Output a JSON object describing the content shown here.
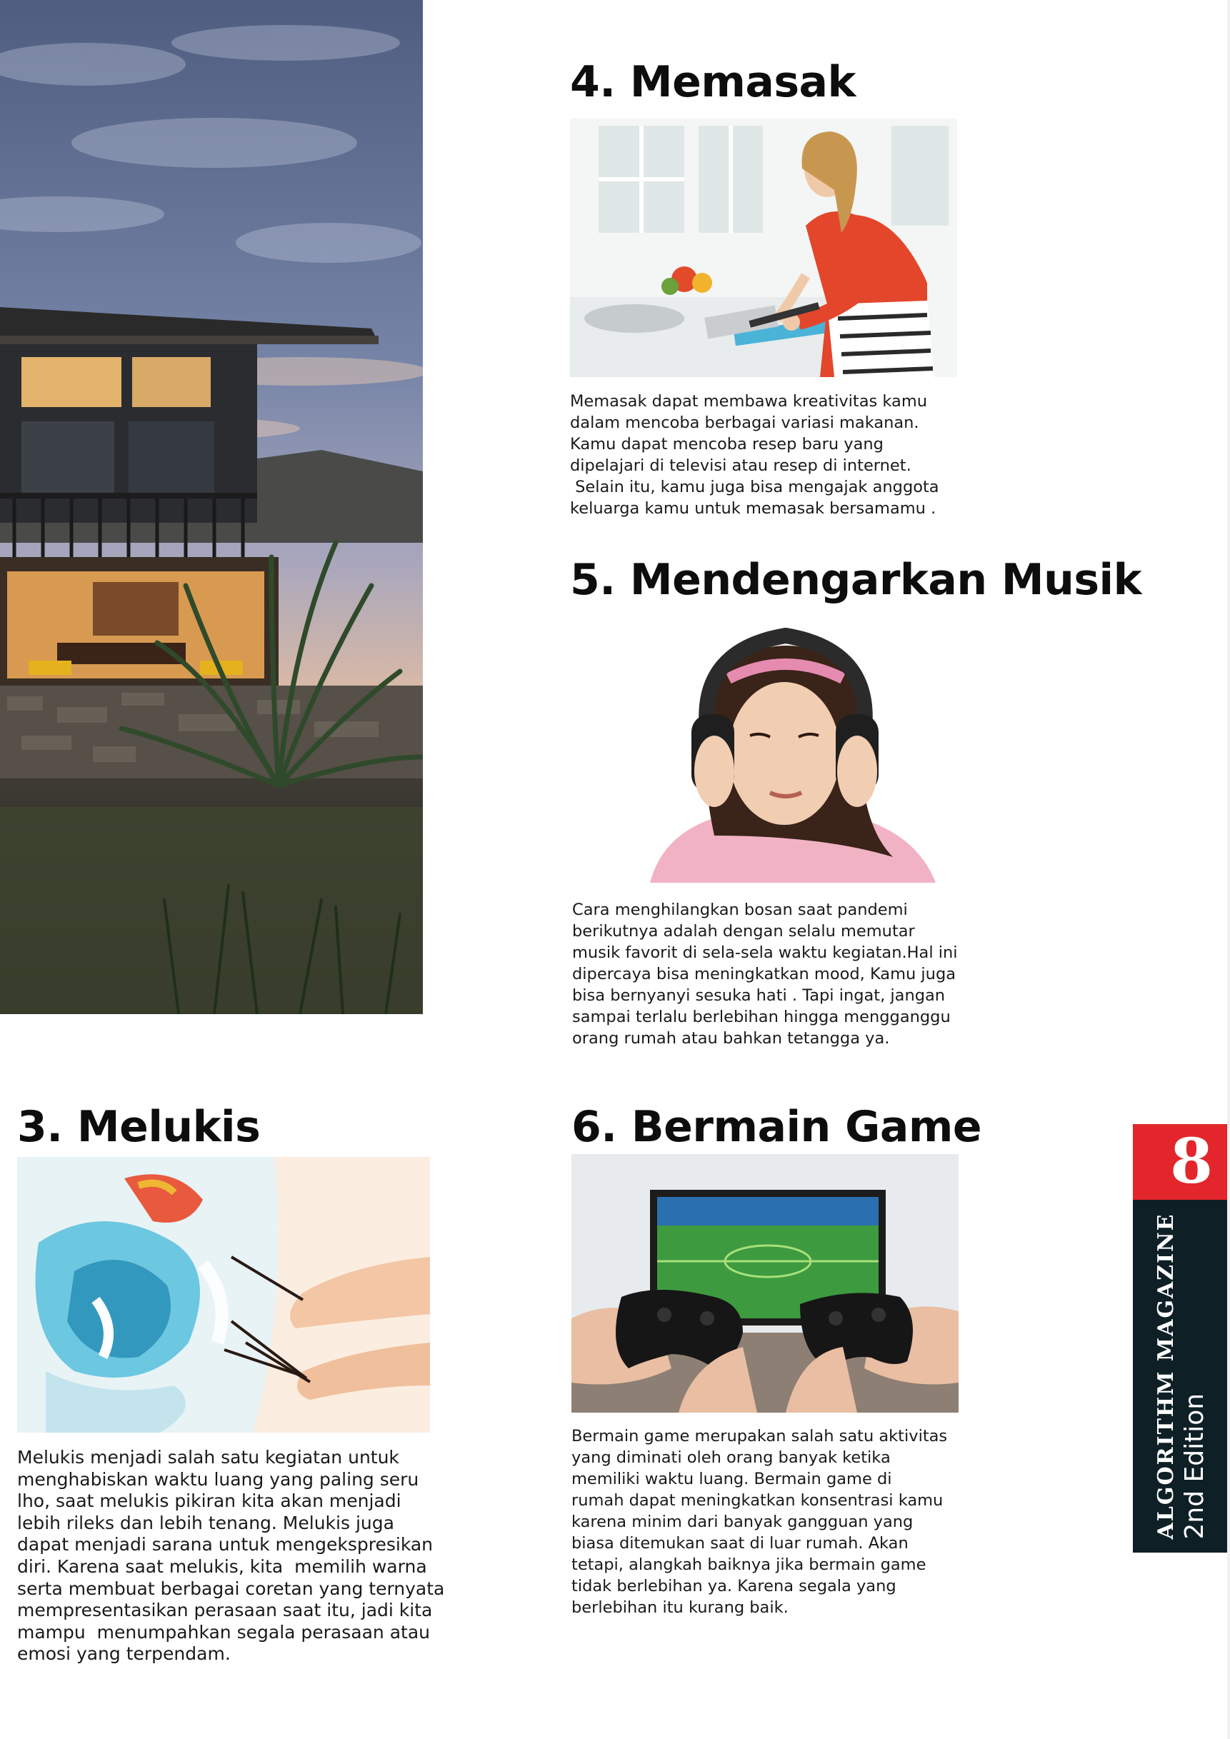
{
  "page": {
    "number": "8",
    "magazine_name": "ALGORITHM MAGAZINE",
    "edition": "2nd Edition",
    "accent_color": "#e2262b",
    "tab_dark_color": "#0f1f26"
  },
  "sections": {
    "memasak": {
      "title": "4. Memasak",
      "image_icon": "woman-cooking-photo",
      "lines": [
        "Memasak dapat membawa kreativitas kamu",
        "dalam mencoba berbagai variasi makanan.",
        "Kamu dapat mencoba resep baru yang",
        "dipelajari di televisi atau resep di internet.",
        " Selain itu, kamu juga bisa mengajak anggota",
        "keluarga kamu untuk memasak bersamamu ."
      ]
    },
    "musik": {
      "title": "5. Mendengarkan Musik",
      "image_icon": "girl-headphones-photo",
      "lines": [
        "Cara menghilangkan bosan saat pandemi",
        "berikutnya adalah dengan selalu memutar",
        "musik favorit di sela-sela waktu kegiatan.Hal ini",
        "dipercaya bisa meningkatkan mood, Kamu juga",
        "bisa bernyanyi sesuka hati . Tapi ingat, jangan",
        "sampai terlalu berlebihan hingga mengganggu",
        "orang rumah atau bahkan tetangga ya."
      ]
    },
    "melukis": {
      "title": "3. Melukis",
      "image_icon": "painting-canvas-photo",
      "lines": [
        "Melukis menjadi salah satu kegiatan untuk",
        "menghabiskan waktu luang yang paling seru",
        "lho, saat melukis pikiran kita akan menjadi",
        "lebih rileks dan lebih tenang. Melukis juga",
        "dapat menjadi sarana untuk mengekspresikan",
        "diri. Karena saat melukis, kita  memilih warna",
        "serta membuat berbagai coretan yang ternyata",
        "mempresentasikan perasaan saat itu, jadi kita",
        "mampu  menumpahkan segala perasaan atau",
        "emosi yang terpendam."
      ]
    },
    "game": {
      "title": "6. Bermain Game",
      "image_icon": "game-controllers-photo",
      "lines": [
        "Bermain game merupakan salah satu aktivitas",
        "yang diminati oleh orang banyak ketika",
        "memiliki waktu luang. Bermain game di",
        "rumah dapat meningkatkan konsentrasi kamu",
        "karena minim dari banyak gangguan yang",
        "biasa ditemukan saat di luar rumah. Akan",
        "tetapi, alangkah baiknya jika bermain game",
        "tidak berlebihan ya. Karena segala yang",
        "berlebihan itu kurang baik."
      ]
    }
  },
  "hero_image": {
    "icon": "modern-house-dusk-photo"
  }
}
